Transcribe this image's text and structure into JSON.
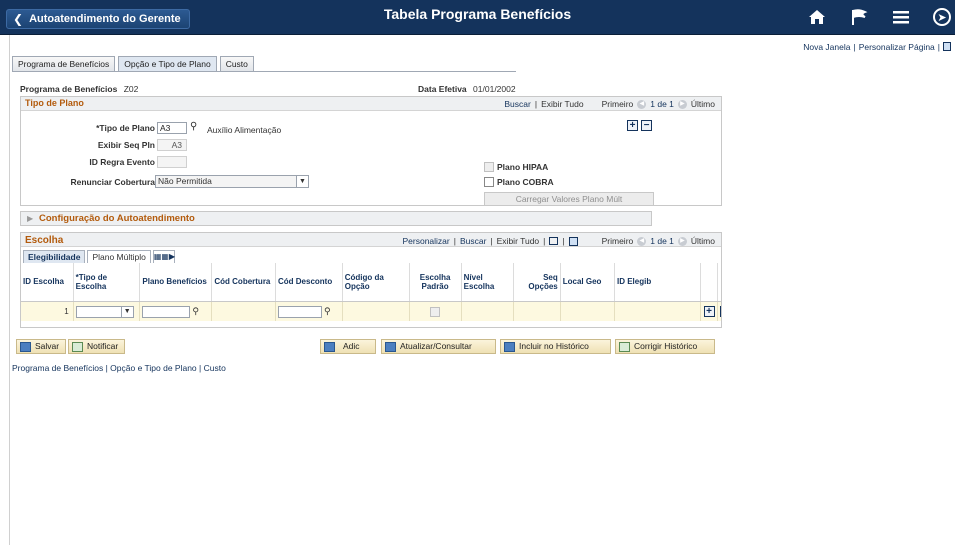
{
  "header": {
    "back_label": "Autoatendimento do Gerente",
    "title": "Tabela Programa Benefícios"
  },
  "toplinks": {
    "new_window": "Nova Janela",
    "sep": "|",
    "personalize": "Personalizar Página",
    "sep2": "|"
  },
  "tabs": [
    {
      "label": "Programa de Benefícios"
    },
    {
      "label": "Opção e Tipo de Plano"
    },
    {
      "label": "Custo"
    }
  ],
  "info": {
    "program_label": "Programa de Benefícios",
    "program_value": "Z02",
    "effdate_label": "Data Efetiva",
    "effdate_value": "01/01/2002"
  },
  "plan_type": {
    "title": "Tipo de Plano",
    "nav": {
      "find": "Buscar",
      "sep": "|",
      "view_all": "Exibir Tudo",
      "first": "Primeiro",
      "count": "1 de 1",
      "last": "Último"
    },
    "plan_type_label": "*Tipo de Plano",
    "plan_type_value": "A3",
    "plan_type_desc": "Auxílio Alimentação",
    "display_seq_label": "Exibir Seq Pln",
    "display_seq_value": "A3",
    "event_rule_label": "ID Regra Evento",
    "event_rule_value": "",
    "waive_label": "Renunciar Cobertura",
    "waive_value": "Não Permitida",
    "hipaa_label": "Plano HIPAA",
    "cobra_label": "Plano COBRA",
    "load_button": "Carregar Valores Plano Múlt"
  },
  "self_service": {
    "title": "Configuração do Autoatendimento"
  },
  "choice": {
    "title": "Escolha",
    "nav": {
      "personalize": "Personalizar",
      "find": "Buscar",
      "view_all": "Exibir Tudo",
      "first": "Primeiro",
      "count": "1 de 1",
      "last": "Último"
    },
    "subtabs": [
      "Elegibilidade",
      "Plano Múltiplo"
    ],
    "columns": [
      "ID Escolha",
      "*Tipo de Escolha",
      "Plano Benefícios",
      "Cód Cobertura",
      "Cód Desconto",
      "Código da Opção",
      "Escolha Padrão",
      "Nível Escolha",
      "Seq Opções",
      "Local Geo",
      "ID Elegib"
    ],
    "row": {
      "id": "1"
    }
  },
  "toolbar": {
    "save": "Salvar",
    "notify": "Notificar",
    "add": "Adic",
    "update": "Atualizar/Consultar",
    "history_include": "Incluir no Histórico",
    "history_correct": "Corrigir Histórico"
  },
  "bottom_links": {
    "link1": "Programa de Benefícios",
    "link2": "Opção e Tipo de Plano",
    "link3": "Custo",
    "sep": "|"
  }
}
